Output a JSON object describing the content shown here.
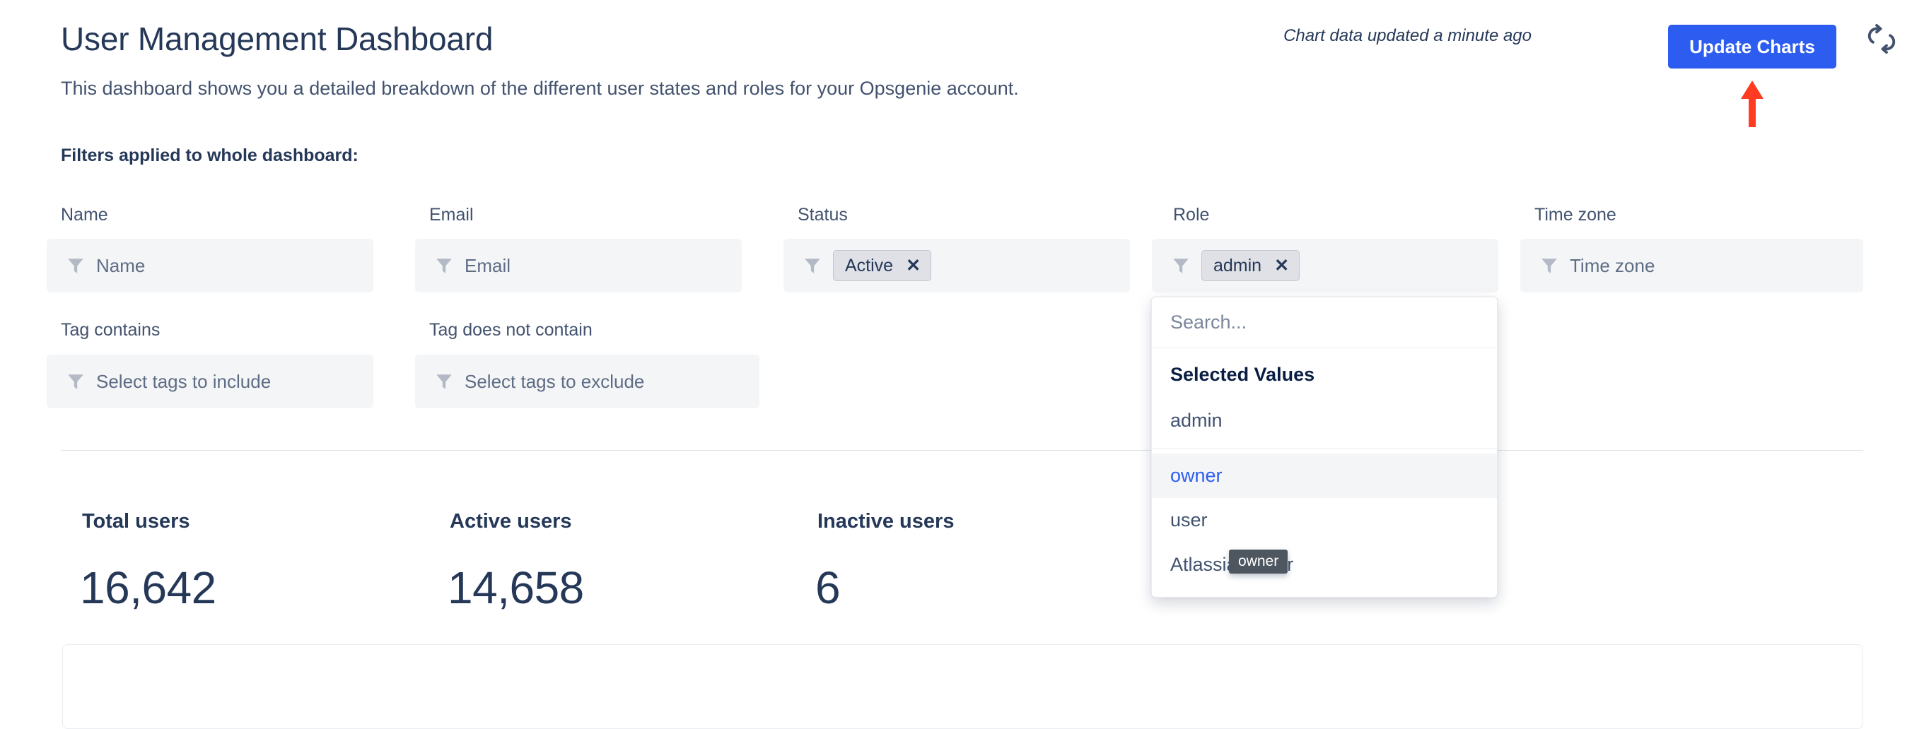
{
  "header": {
    "title": "User Management Dashboard",
    "subtitle": "This dashboard shows you a detailed breakdown of the different user states and roles for your Opsgenie account.",
    "chart_updated": "Chart data updated a minute ago",
    "update_button": "Update Charts",
    "refresh_icon": "refresh-icon",
    "accent_color": "#2D5DF0",
    "arrow_color": "#FF3B21"
  },
  "filters": {
    "heading": "Filters applied to whole dashboard:",
    "fields": [
      {
        "label": "Name",
        "placeholder": "Name",
        "icon": "funnel-icon",
        "chips": []
      },
      {
        "label": "Email",
        "placeholder": "Email",
        "icon": "funnel-icon",
        "chips": []
      },
      {
        "label": "Status",
        "placeholder": "",
        "icon": "funnel-icon",
        "chips": [
          "Active"
        ]
      },
      {
        "label": "Role",
        "placeholder": "",
        "icon": "funnel-icon",
        "chips": [
          "admin"
        ]
      },
      {
        "label": "Time zone",
        "placeholder": "Time zone",
        "icon": "funnel-icon",
        "chips": []
      },
      {
        "label": "Tag contains",
        "placeholder": "Select tags to include",
        "icon": "funnel-icon",
        "chips": []
      },
      {
        "label": "Tag does not contain",
        "placeholder": "Select tags to exclude",
        "icon": "funnel-icon",
        "chips": []
      }
    ],
    "chip_remove_glyph": "✕"
  },
  "role_dropdown": {
    "search_value": "",
    "search_placeholder": "Search...",
    "selected_values_heading": "Selected Values",
    "selected_values": [
      "admin"
    ],
    "options": [
      "owner",
      "user",
      "Atlassian User"
    ],
    "highlighted_option": "owner",
    "tooltip": "owner"
  },
  "stats": [
    {
      "title": "Total users",
      "value": "16,642"
    },
    {
      "title": "Active users",
      "value": "14,658"
    },
    {
      "title": "Inactive users",
      "value": "6"
    }
  ]
}
